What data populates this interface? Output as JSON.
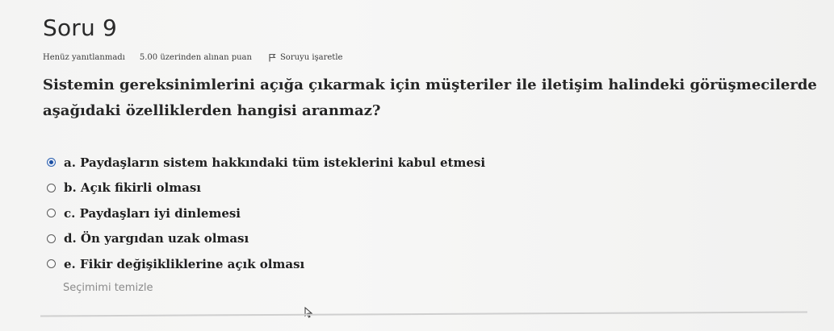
{
  "question": {
    "title": "Soru 9",
    "status": "Henüz yanıtlanmadı",
    "points": "5.00 üzerinden alınan puan",
    "flag_label": "Soruyu işaretle",
    "text": "Sistemin gereksinimlerini açığa çıkarmak için müşteriler ile iletişim halindeki görüşmecilerde aşağıdaki özelliklerden hangisi aranmaz?",
    "options": [
      {
        "label": "a. Paydaşların sistem hakkındaki tüm isteklerini kabul etmesi",
        "selected": true
      },
      {
        "label": "b. Açık fikirli olması",
        "selected": false
      },
      {
        "label": "c. Paydaşları iyi dinlemesi",
        "selected": false
      },
      {
        "label": "d. Ön yargıdan uzak olması",
        "selected": false
      },
      {
        "label": "e. Fikir değişikliklerine açık olması",
        "selected": false
      }
    ],
    "clear_label": "Seçimimi temizle"
  },
  "colors": {
    "radio_selected": "#1b4fa3",
    "clear_link": "#8a8a8a"
  }
}
